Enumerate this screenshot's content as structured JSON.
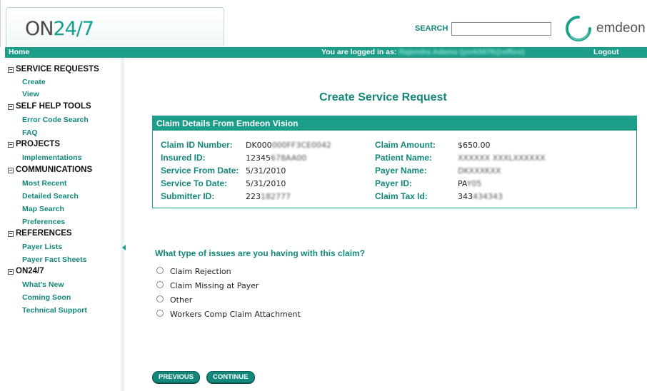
{
  "header": {
    "logo_part1": "ON",
    "logo_part2": "24/7",
    "search_label": "SEARCH",
    "search_value": "",
    "brand_name": "emdeon",
    "brand_color": "#1d9e8a"
  },
  "navbar": {
    "home": "Home",
    "logged_in_label": "You are logged in as:",
    "user": "Rajendra Adama (york5678@office)",
    "logout": "Logout"
  },
  "sidebar": {
    "sections": [
      {
        "title": "SERVICE REQUESTS",
        "items": [
          "Create",
          "View"
        ]
      },
      {
        "title": "SELF HELP TOOLS",
        "items": [
          "Error Code Search",
          "FAQ"
        ]
      },
      {
        "title": "PROJECTS",
        "items": [
          "Implementations"
        ]
      },
      {
        "title": "COMMUNICATIONS",
        "items": [
          "Most Recent",
          "Detailed Search",
          "Map Search",
          "Preferences"
        ]
      },
      {
        "title": "REFERENCES",
        "items": [
          "Payer Lists",
          "Payer Fact Sheets"
        ]
      },
      {
        "title": "ON24/7",
        "items": [
          "What's New",
          "Coming Soon",
          "Technical Support"
        ]
      }
    ],
    "collapse_glyph": "◀"
  },
  "main": {
    "title": "Create Service Request",
    "panel": {
      "header": "Claim Details From Emdeon Vision",
      "fields": {
        "claim_id_label": "Claim ID Number:",
        "claim_id_value": "DK000",
        "claim_id_value_masked": "000FF3CE0042",
        "insured_id_label": "Insured ID:",
        "insured_id_value": "12345",
        "insured_id_value_masked": "678AA00",
        "service_from_label": "Service From Date:",
        "service_from_value": "5/31/2010",
        "service_to_label": "Service To Date:",
        "service_to_value": "5/31/2010",
        "submitter_id_label": "Submitter ID:",
        "submitter_id_value": "223",
        "submitter_id_value_masked": "182777",
        "claim_amount_label": "Claim Amount:",
        "claim_amount_value": "$650.00",
        "patient_name_label": "Patient Name:",
        "patient_name_value_masked": "XXXXXX XXXLXXXXXX",
        "payer_name_label": "Payer Name:",
        "payer_name_value_masked": "DKXXXKXX",
        "payer_id_label": "Payer ID:",
        "payer_id_value": "PA",
        "payer_id_value_masked": "Y05",
        "claim_tax_label": "Claim Tax Id:",
        "claim_tax_value": "343",
        "claim_tax_value_masked": "434343"
      }
    },
    "question": "What type of issues are you having with this claim?",
    "options": [
      "Claim Rejection",
      "Claim Missing at Payer",
      "Other",
      "Workers Comp Claim Attachment"
    ],
    "buttons": {
      "previous": "PREVIOUS",
      "continue": "CONTINUE"
    }
  }
}
